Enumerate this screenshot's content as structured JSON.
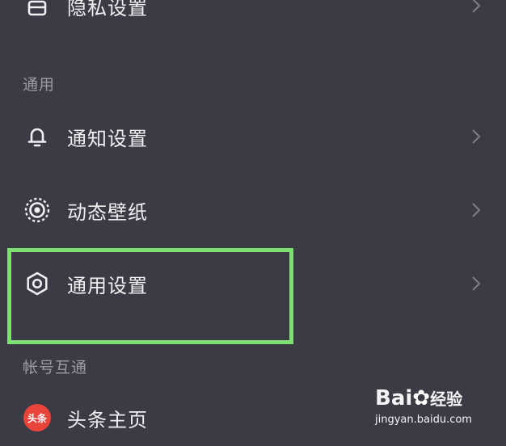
{
  "rows": {
    "privacy": {
      "label": "隐私设置",
      "icon": "lock-icon"
    },
    "notify": {
      "label": "通知设置",
      "icon": "bell-icon"
    },
    "wallpaper": {
      "label": "动态壁纸",
      "icon": "live-wallpaper-icon"
    },
    "general": {
      "label": "通用设置",
      "icon": "gear-icon"
    },
    "toutiao": {
      "label": "头条主页",
      "icon": "toutiao-logo",
      "logo_text": "头条"
    }
  },
  "sections": {
    "general": "通用",
    "account": "帐号互通"
  },
  "watermark": {
    "brand": "Bai",
    "brand_suffix": "经验",
    "url": "jingyan.baidu.com"
  },
  "colors": {
    "background": "#3b3b45",
    "highlight": "#7fe072",
    "section_text": "#9c9ca6",
    "toutiao": "#e8443a"
  }
}
